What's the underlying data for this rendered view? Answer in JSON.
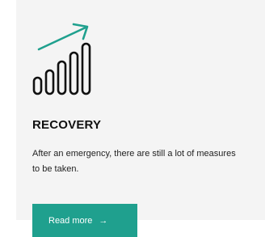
{
  "card": {
    "icon": "growth-chart-icon",
    "title": "RECOVERY",
    "description": "After an emergency, there are still a lot of measures to be taken.",
    "button_label": "Read more",
    "button_arrow": "→"
  },
  "colors": {
    "accent": "#1fa08e",
    "card_background": "#f4f4f4",
    "text": "#111111"
  }
}
